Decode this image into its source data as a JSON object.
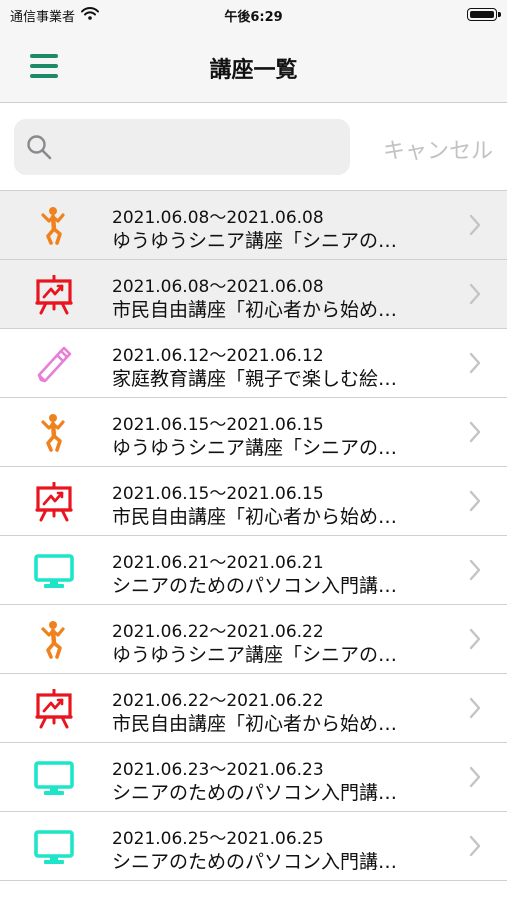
{
  "status": {
    "carrier": "通信事業者",
    "time": "午後6:29"
  },
  "nav": {
    "title": "講座一覧"
  },
  "search": {
    "placeholder": "",
    "cancel_label": "キャンセル"
  },
  "colors": {
    "accent": "#1d8a67",
    "runner": "#f0821e",
    "easel": "#e8141e",
    "pencil": "#e87fd6",
    "monitor": "#1de6c8"
  },
  "courses": [
    {
      "date": "2021.06.08～2021.06.08",
      "title": "ゆうゆうシニア講座「シニアの…",
      "icon": "runner-icon",
      "highlighted": true
    },
    {
      "date": "2021.06.08～2021.06.08",
      "title": "市民自由講座「初心者から始め…",
      "icon": "easel-icon",
      "highlighted": true
    },
    {
      "date": "2021.06.12～2021.06.12",
      "title": "家庭教育講座「親子で楽しむ絵…",
      "icon": "pencil-icon",
      "highlighted": false
    },
    {
      "date": "2021.06.15～2021.06.15",
      "title": "ゆうゆうシニア講座「シニアの…",
      "icon": "runner-icon",
      "highlighted": false
    },
    {
      "date": "2021.06.15～2021.06.15",
      "title": "市民自由講座「初心者から始め…",
      "icon": "easel-icon",
      "highlighted": false
    },
    {
      "date": "2021.06.21～2021.06.21",
      "title": "シニアのためのパソコン入門講…",
      "icon": "monitor-icon",
      "highlighted": false
    },
    {
      "date": "2021.06.22～2021.06.22",
      "title": "ゆうゆうシニア講座「シニアの…",
      "icon": "runner-icon",
      "highlighted": false
    },
    {
      "date": "2021.06.22～2021.06.22",
      "title": "市民自由講座「初心者から始め…",
      "icon": "easel-icon",
      "highlighted": false
    },
    {
      "date": "2021.06.23～2021.06.23",
      "title": "シニアのためのパソコン入門講…",
      "icon": "monitor-icon",
      "highlighted": false
    },
    {
      "date": "2021.06.25～2021.06.25",
      "title": "シニアのためのパソコン入門講…",
      "icon": "monitor-icon",
      "highlighted": false
    }
  ]
}
